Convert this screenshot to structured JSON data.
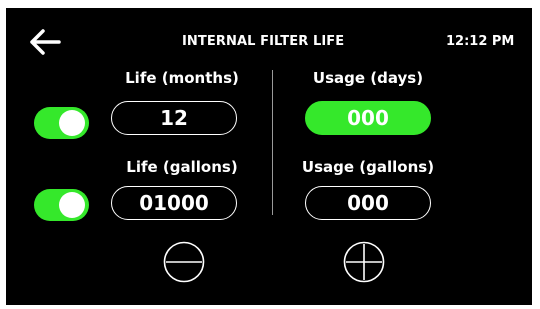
{
  "header": {
    "back_icon": "arrow-left-icon",
    "title": "INTERNAL FILTER LIFE",
    "time": "12:12 PM"
  },
  "left": {
    "life_months": {
      "label": "Life (months)",
      "value": "12",
      "enabled": true
    },
    "life_gallons": {
      "label": "Life (gallons)",
      "value": "01000",
      "enabled": true
    }
  },
  "right": {
    "usage_days": {
      "label": "Usage (days)",
      "value": "000",
      "selected": true
    },
    "usage_gallons": {
      "label": "Usage (gallons)",
      "value": "000",
      "selected": false
    }
  },
  "controls": {
    "decrement_icon": "minus-icon",
    "increment_icon": "plus-icon"
  },
  "colors": {
    "background": "#000000",
    "accent": "#35e82b",
    "text": "#ffffff"
  }
}
